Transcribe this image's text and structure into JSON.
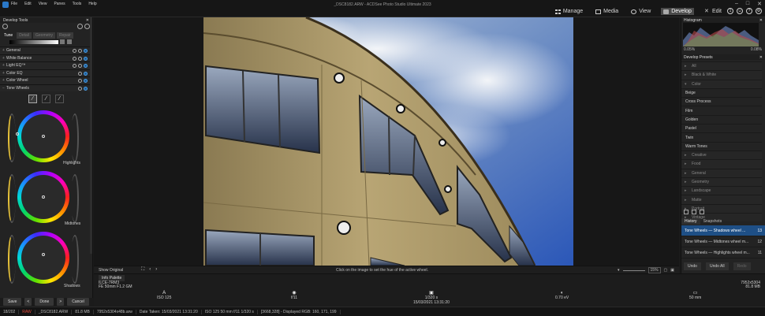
{
  "window": {
    "title": "_DSC8182.ARW - ACDSee Photo Studio Ultimate 2023",
    "menu": [
      "File",
      "Edit",
      "View",
      "Panes",
      "Tools",
      "Help"
    ],
    "controls": [
      "–",
      "□",
      "✕"
    ]
  },
  "modes": {
    "manage": "Manage",
    "media": "Media",
    "view": "View",
    "develop": "Develop",
    "edit": "Edit",
    "active": "Develop"
  },
  "left_panel": {
    "title": "Develop Tools",
    "tabs": [
      "Tune",
      "Detail",
      "Geometry",
      "Repair"
    ],
    "sections": [
      "General",
      "White Balance",
      "Light EQ™",
      "Color EQ",
      "Color Wheel",
      "Tone Wheels"
    ],
    "wheels": [
      {
        "label": "Highlights",
        "ring_color": "#e6c23a"
      },
      {
        "label": "Midtones",
        "ring_color": "#e6c23a"
      },
      {
        "label": "Shadows",
        "ring_color": "#e6c23a"
      }
    ],
    "buttons": {
      "save": "Save",
      "done": "Done",
      "cancel": "Cancel",
      "prev": "<",
      "next": ">"
    }
  },
  "view_bar": {
    "show_original": "Show Original",
    "hint": "Click on the image to set the hue of the active wheel.",
    "zoom": "15%"
  },
  "info_palette": {
    "title": "Info Palette",
    "camera": "ILCE-7RM3",
    "lens": "FE 50mm F1.2 GM",
    "dimensions": "7952x5304",
    "file_size": "81.8 MB",
    "columns": [
      {
        "icon": "A",
        "value": "ISO 125"
      },
      {
        "icon": "◉",
        "value": "f/11"
      },
      {
        "icon": "▣",
        "value": "1/320 s",
        "sub": "15/03/2021 13:31:20"
      },
      {
        "icon": "◐",
        "value": "0.70 eV"
      },
      {
        "icon": "▭",
        "value": "50 mm"
      }
    ]
  },
  "right_panel": {
    "histogram_title": "Histogram",
    "hist_left": "0.05%",
    "hist_right": "0.08%",
    "presets_title": "Develop Presets",
    "presets": [
      {
        "label": "All",
        "type": "cat"
      },
      {
        "label": "Black & White",
        "type": "cat"
      },
      {
        "label": "Color",
        "type": "cat"
      },
      {
        "label": "Beige",
        "type": "leaf"
      },
      {
        "label": "Cross Process",
        "type": "leaf"
      },
      {
        "label": "Film",
        "type": "leaf"
      },
      {
        "label": "Golden",
        "type": "leaf"
      },
      {
        "label": "Pastel",
        "type": "leaf"
      },
      {
        "label": "Twin",
        "type": "leaf"
      },
      {
        "label": "Warm Tones",
        "type": "leaf"
      },
      {
        "label": "Creative",
        "type": "cat"
      },
      {
        "label": "Food",
        "type": "cat"
      },
      {
        "label": "General",
        "type": "cat"
      },
      {
        "label": "Geometry",
        "type": "cat"
      },
      {
        "label": "Landscape",
        "type": "cat"
      },
      {
        "label": "Matte",
        "type": "cat"
      },
      {
        "label": "Portrait",
        "type": "cat"
      },
      {
        "label": "Vintage",
        "type": "cat"
      }
    ],
    "history_tabs": [
      "History",
      "Snapshots"
    ],
    "history": [
      {
        "label": "Tone Wheels — Shadows wheel ...",
        "num": "13"
      },
      {
        "label": "Tone Wheels — Midtones wheel m...",
        "num": "12"
      },
      {
        "label": "Tone Wheels — Highlights wheel m...",
        "num": "11"
      }
    ],
    "undo": "Undo",
    "undo_all": "Undo All",
    "redo": "Redo"
  },
  "statusbar": [
    "18/202",
    "RAW",
    "_DSC8182.ARW",
    "81.8 MB",
    "7952x5304x48b.arw",
    "Date Taken: 15/03/2021 13:31:20",
    "ISO 125   50 mm   f/11   1/320 s",
    "[3668,328] - Displayed RGB: 160, 171, 199"
  ]
}
